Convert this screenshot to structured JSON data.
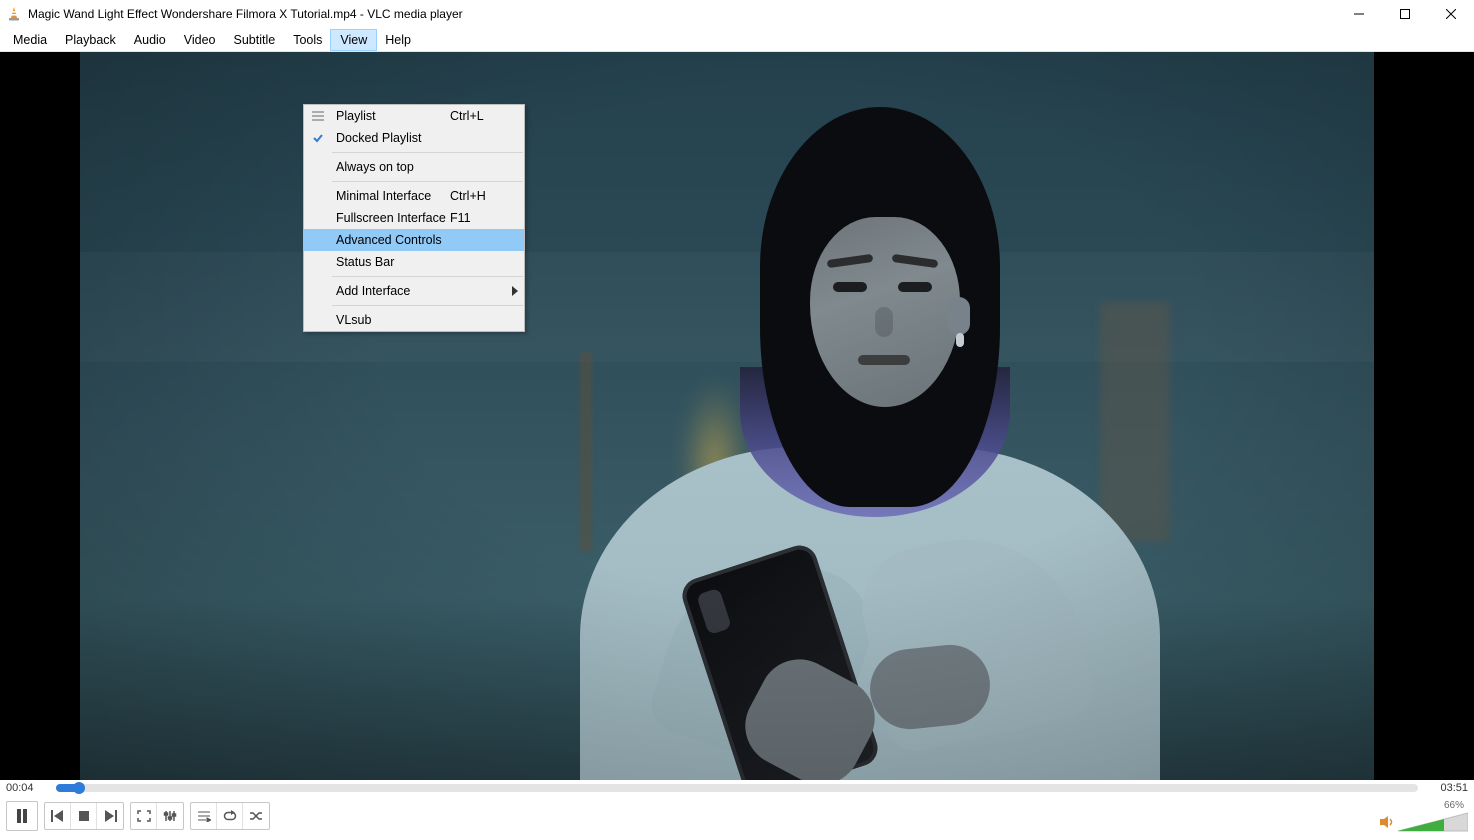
{
  "window": {
    "title": "Magic Wand Light Effect  Wondershare Filmora X Tutorial.mp4 - VLC media player"
  },
  "menubar": [
    "Media",
    "Playback",
    "Audio",
    "Video",
    "Subtitle",
    "Tools",
    "View",
    "Help"
  ],
  "active_menu_index": 6,
  "view_menu": [
    {
      "type": "item",
      "icon": "list",
      "label": "Playlist",
      "accel": "Ctrl+L"
    },
    {
      "type": "item",
      "icon": "check",
      "label": "Docked Playlist",
      "accel": ""
    },
    {
      "type": "sep"
    },
    {
      "type": "item",
      "icon": "",
      "label": "Always on top",
      "accel": ""
    },
    {
      "type": "sep"
    },
    {
      "type": "item",
      "icon": "",
      "label": "Minimal Interface",
      "accel": "Ctrl+H"
    },
    {
      "type": "item",
      "icon": "",
      "label": "Fullscreen Interface",
      "accel": "F11"
    },
    {
      "type": "item",
      "icon": "",
      "label": "Advanced Controls",
      "accel": "",
      "highlight": true
    },
    {
      "type": "item",
      "icon": "",
      "label": "Status Bar",
      "accel": ""
    },
    {
      "type": "sep"
    },
    {
      "type": "item",
      "icon": "",
      "label": "Add Interface",
      "accel": "",
      "submenu": true
    },
    {
      "type": "sep"
    },
    {
      "type": "item",
      "icon": "",
      "label": "VLsub",
      "accel": ""
    }
  ],
  "player": {
    "elapsed": "00:04",
    "total": "03:51",
    "progress_pct": 1.7,
    "volume_pct_label": "66%",
    "volume_pct": 66
  }
}
